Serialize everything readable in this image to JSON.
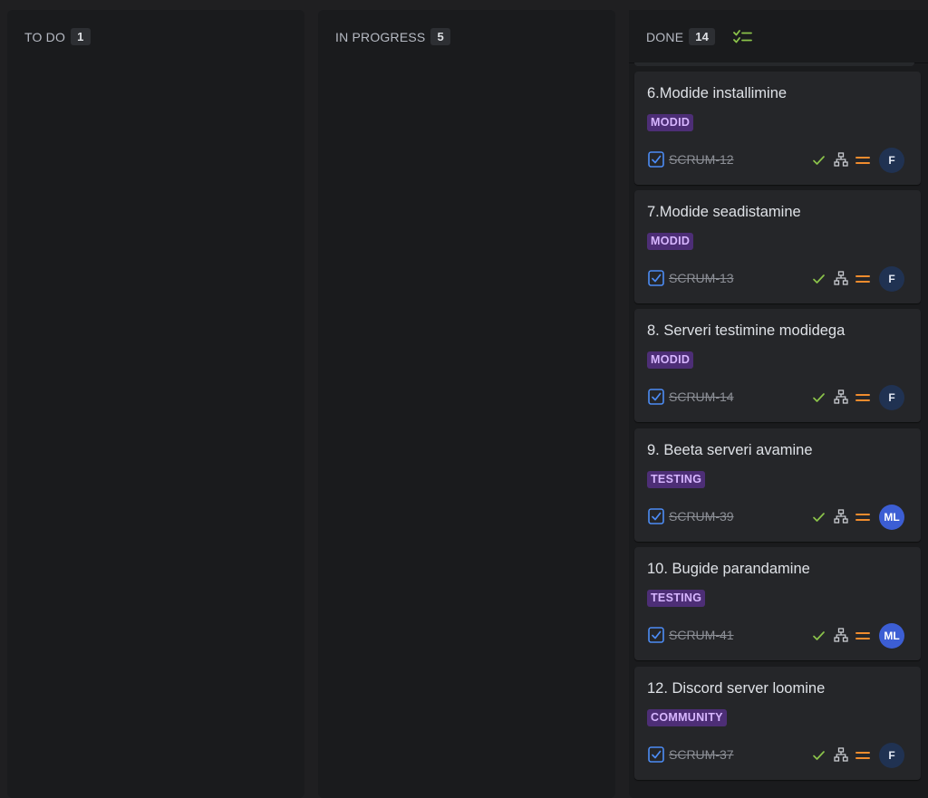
{
  "columns": [
    {
      "label": "TO DO",
      "count": "1"
    },
    {
      "label": "IN PROGRESS",
      "count": "5"
    },
    {
      "label": "DONE",
      "count": "14"
    }
  ],
  "colors": {
    "badge_bg": "#4d2e76",
    "badge_text": "#d7b6ff",
    "done_check": "#8bc34a",
    "priority": "#f08c2e",
    "checkbox": "#4c8cf5"
  },
  "cards": [
    {
      "title": "6.Modide installimine",
      "label": "MODID",
      "key": "SCRUM-12",
      "assignee": "F",
      "avatar_color": "#203252"
    },
    {
      "title": "7.Modide seadistamine",
      "label": "MODID",
      "key": "SCRUM-13",
      "assignee": "F",
      "avatar_color": "#203252"
    },
    {
      "title": "8. Serveri testimine modidega",
      "label": "MODID",
      "key": "SCRUM-14",
      "assignee": "F",
      "avatar_color": "#203252"
    },
    {
      "title": "9. Beeta serveri avamine",
      "label": "TESTING",
      "key": "SCRUM-39",
      "assignee": "ML",
      "avatar_color": "#3c5ed4"
    },
    {
      "title": "10. Bugide parandamine",
      "label": "TESTING",
      "key": "SCRUM-41",
      "assignee": "ML",
      "avatar_color": "#3c5ed4"
    },
    {
      "title": "12. Discord server loomine",
      "label": "COMMUNITY",
      "key": "SCRUM-37",
      "assignee": "F",
      "avatar_color": "#203252"
    }
  ]
}
